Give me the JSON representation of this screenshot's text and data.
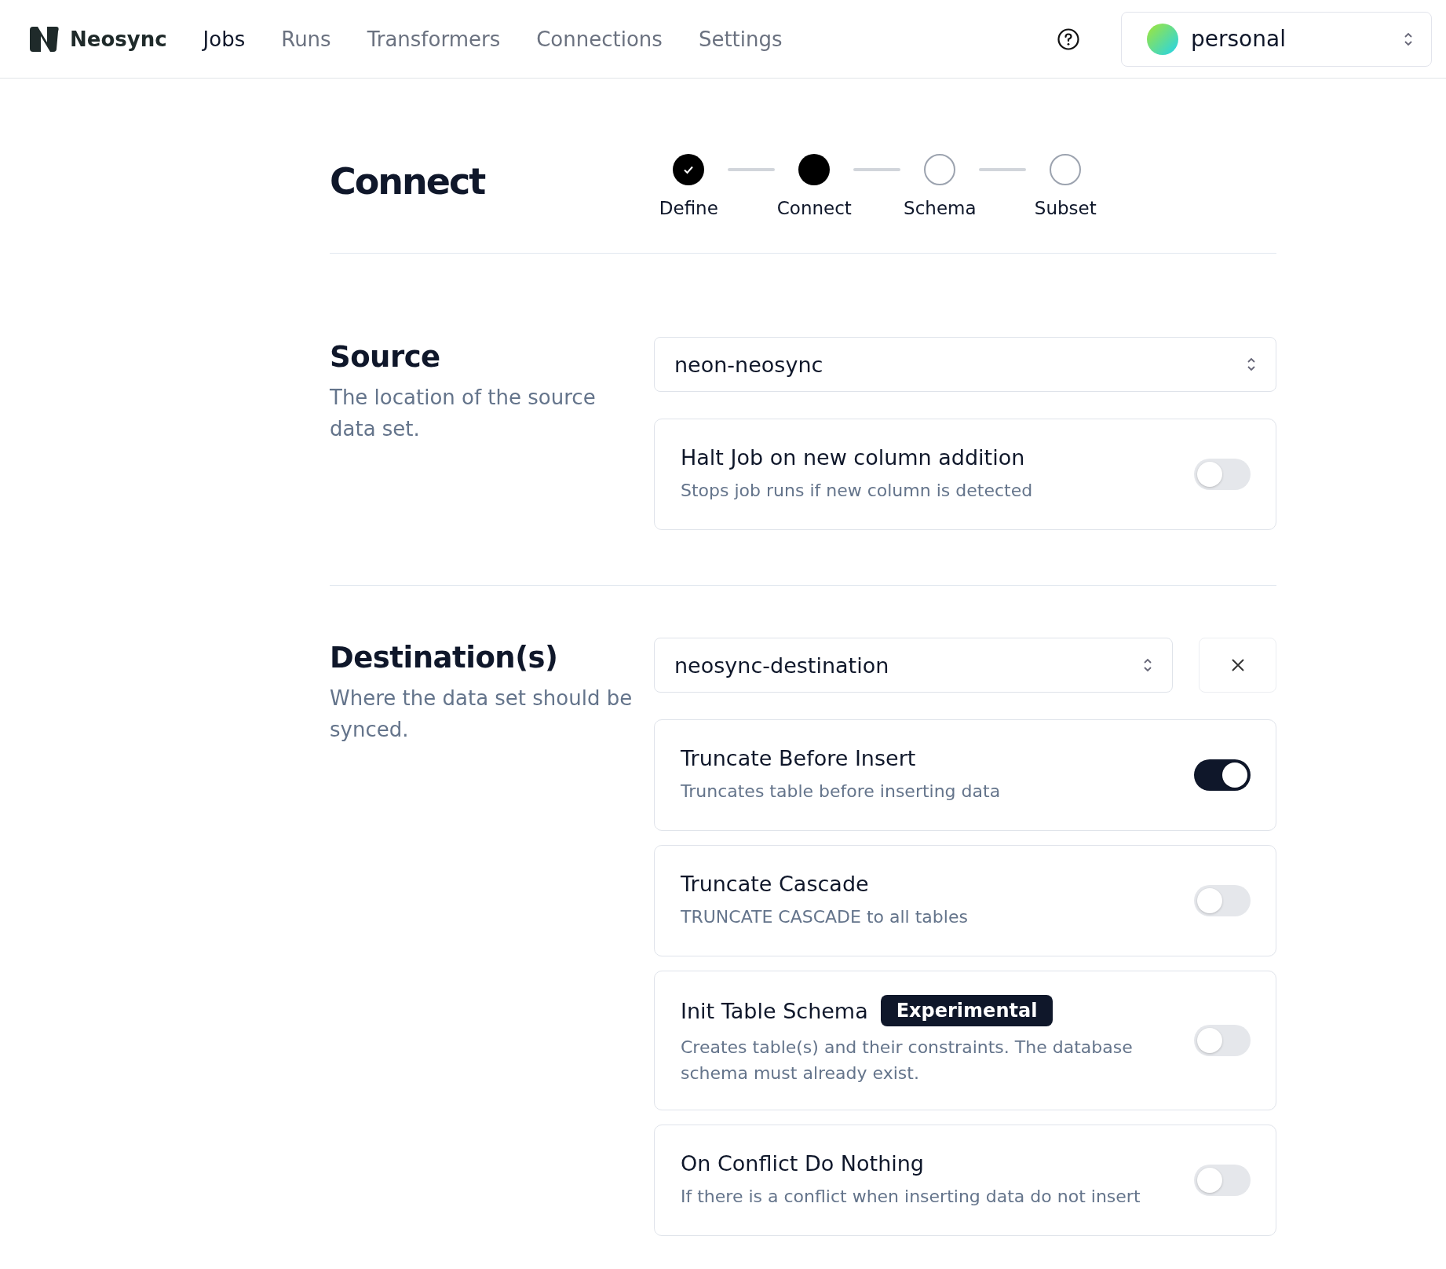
{
  "brand": {
    "name": "Neosync"
  },
  "nav": [
    {
      "label": "Jobs",
      "selected": true
    },
    {
      "label": "Runs",
      "selected": false
    },
    {
      "label": "Transformers",
      "selected": false
    },
    {
      "label": "Connections",
      "selected": false
    },
    {
      "label": "Settings",
      "selected": false
    }
  ],
  "account": {
    "value": "personal"
  },
  "page": {
    "title": "Connect"
  },
  "steps": [
    {
      "label": "Define",
      "kind": "done"
    },
    {
      "label": "Connect",
      "kind": "current"
    },
    {
      "label": "Schema",
      "kind": "upcoming"
    },
    {
      "label": "Subset",
      "kind": "upcoming"
    }
  ],
  "source": {
    "heading": "Source",
    "description": "The location of the source data set.",
    "value": "neon-neosync",
    "options": [
      {
        "title": "Halt Job on new column addition",
        "description": "Stops job runs if new column is detected",
        "on": false
      }
    ]
  },
  "destination": {
    "heading": "Destination(s)",
    "description": "Where the data set should be synced.",
    "value": "neosync-destination",
    "options": [
      {
        "title": "Truncate Before Insert",
        "description": "Truncates table before inserting data",
        "on": true
      },
      {
        "title": "Truncate Cascade",
        "description": "TRUNCATE CASCADE to all tables",
        "on": false
      },
      {
        "title": "Init Table Schema",
        "badge": "Experimental",
        "description": "Creates table(s) and their constraints. The database schema must already exist.",
        "on": false
      },
      {
        "title": "On Conflict Do Nothing",
        "description": "If there is a conflict when inserting data do not insert",
        "on": false
      }
    ]
  }
}
